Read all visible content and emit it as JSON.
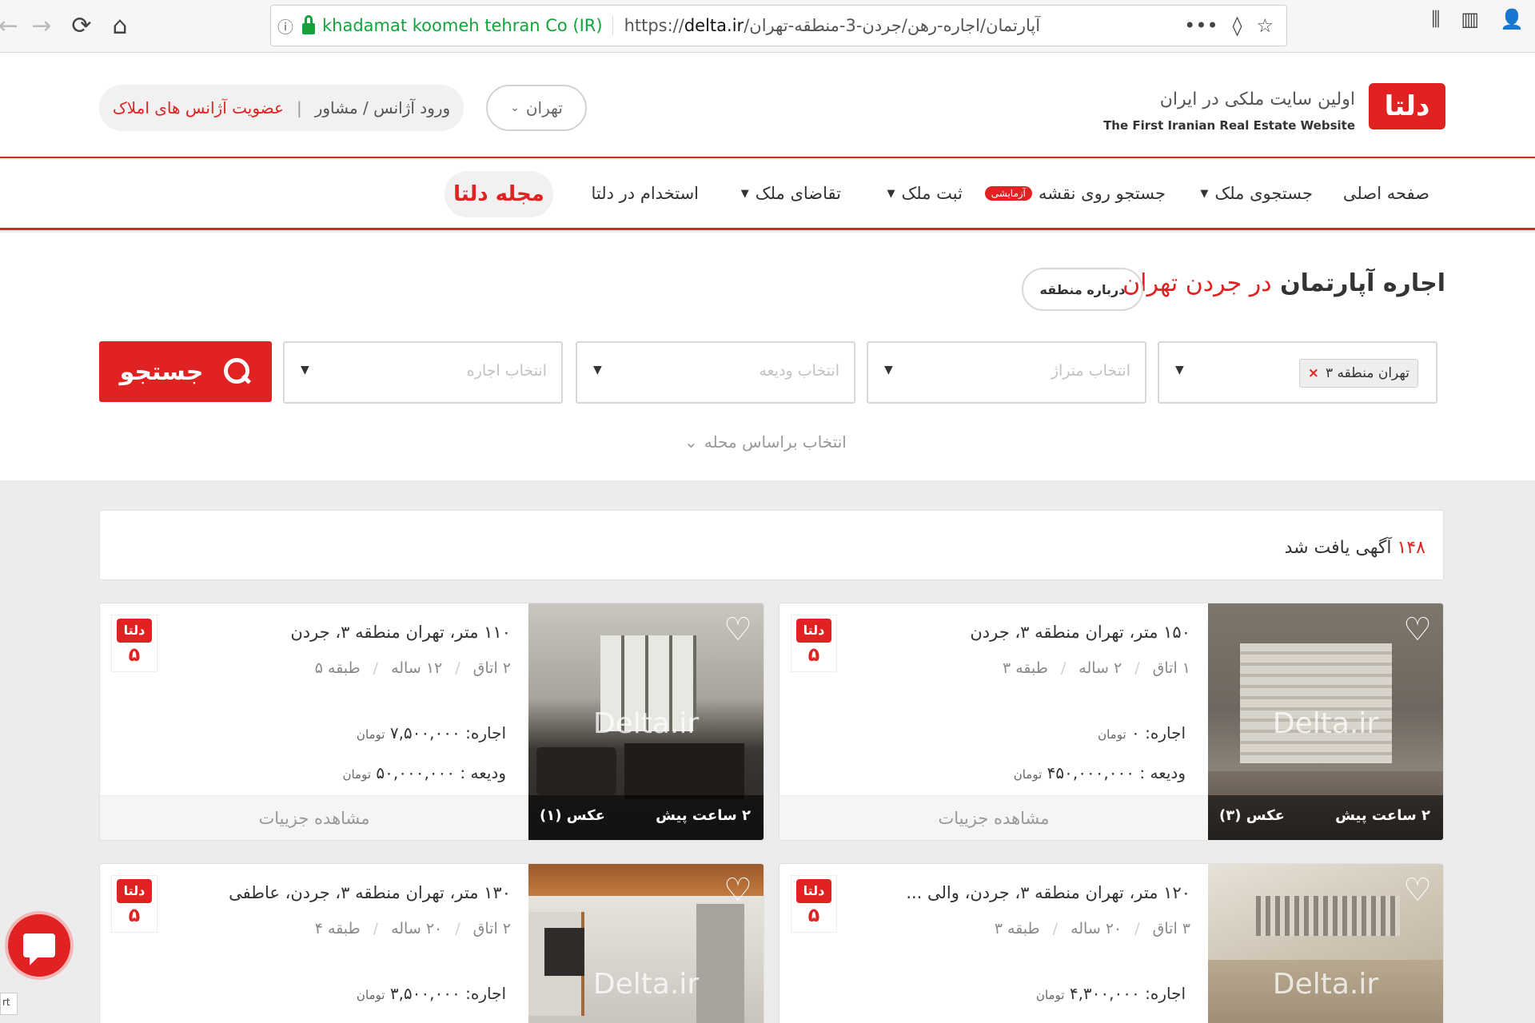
{
  "browser": {
    "back_icon": "←",
    "forward_icon": "→",
    "reload_icon": "⟳",
    "home_icon": "⌂",
    "info_icon": "ⓘ",
    "site_owner": "khadamat koomeh tehran Co (IR)",
    "url_prefix": "https://",
    "url_domain": "delta.ir",
    "url_path": "/آپارتمان/اجاره-رهن/جردن-3-منطقه-تهران",
    "more_icon": "•••",
    "pocket_icon": "◊",
    "star_icon": "☆",
    "library_icon": "⫼",
    "sidebar_icon": "▥",
    "account_icon": "👤"
  },
  "header": {
    "logo_text": "دلتا",
    "tagline_fa": "اولین سایت ملکی در ایران",
    "tagline_en": "The First Iranian Real Estate Website",
    "city": "تهران",
    "agency_login": "ورود آژانس / مشاور",
    "agency_separator": "|",
    "agency_join": "عضویت آژانس های املاک"
  },
  "nav": {
    "home": "صفحه اصلی",
    "search_property": "جستجوی ملک",
    "map_search": "جستجو روی نقشه",
    "trial_badge": "آزمایشی",
    "register_property": "ثبت ملک",
    "property_request": "تقاضای ملک",
    "jobs": "استخدام در دلتا",
    "magazine": "مجله دلتا",
    "caret": "▼"
  },
  "search": {
    "title_main": "اجاره آپارتمان",
    "title_location": "در جردن تهران",
    "about_area": "درباره منطقه",
    "region_tag": "تهران منطقه ۳",
    "region_remove": "×",
    "area_placeholder": "انتخاب متراژ",
    "deposit_placeholder": "انتخاب ودیعه",
    "rent_placeholder": "انتخاب اجاره",
    "dropdown_arrow": "▼",
    "search_button": "جستجو",
    "neighborhood_toggle": "انتخاب براساس محله",
    "toggle_chevron": "⌄"
  },
  "results": {
    "count": "۱۴۸",
    "count_label": "آگهی یافت شد"
  },
  "listings": [
    {
      "title": "۱۵۰ متر، تهران منطقه ۳، جردن",
      "rooms": "۱ اتاق",
      "age": "۲ ساله",
      "floor": "طبقه ۳",
      "rent": "اجاره: ۰",
      "deposit": "ودیعه : ۴۵۰,۰۰۰,۰۰۰",
      "unit": "تومان",
      "time": "۲ ساعت پیش",
      "photos": "عکس (۳)",
      "details": "مشاهده جزییات",
      "watermark": "Delta.ir",
      "heart_icon": "♡",
      "agency_mark": "دلتا",
      "agency_num": "۵"
    },
    {
      "title": "۱۱۰ متر، تهران منطقه ۳، جردن",
      "rooms": "۲ اتاق",
      "age": "۱۲ ساله",
      "floor": "طبقه ۵",
      "rent": "اجاره: ۷,۵۰۰,۰۰۰",
      "deposit": "ودیعه : ۵۰,۰۰۰,۰۰۰",
      "unit": "تومان",
      "time": "۲ ساعت پیش",
      "photos": "عکس (۱)",
      "details": "مشاهده جزییات",
      "watermark": "Delta.ir",
      "heart_icon": "♡",
      "agency_mark": "دلتا",
      "agency_num": "۵"
    },
    {
      "title": "۱۲۰ متر، تهران منطقه ۳، جردن، والی ...",
      "rooms": "۳ اتاق",
      "age": "۲۰ ساله",
      "floor": "طبقه ۳",
      "rent": "اجاره: ۴,۳۰۰,۰۰۰",
      "unit": "تومان",
      "watermark": "Delta.ir",
      "heart_icon": "♡",
      "agency_mark": "دلتا",
      "agency_num": "۵"
    },
    {
      "title": "۱۳۰ متر، تهران منطقه ۳، جردن، عاطفی",
      "rooms": "۲ اتاق",
      "age": "۲۰ ساله",
      "floor": "طبقه ۴",
      "rent": "اجاره: ۳,۵۰۰,۰۰۰",
      "unit": "تومان",
      "watermark": "Delta.ir",
      "heart_icon": "♡",
      "agency_mark": "دلتا",
      "agency_num": "۵"
    }
  ],
  "misc": {
    "corner_tab": "rt"
  },
  "colors": {
    "brand_red": "#e02222",
    "secure_green": "#12a33a"
  }
}
